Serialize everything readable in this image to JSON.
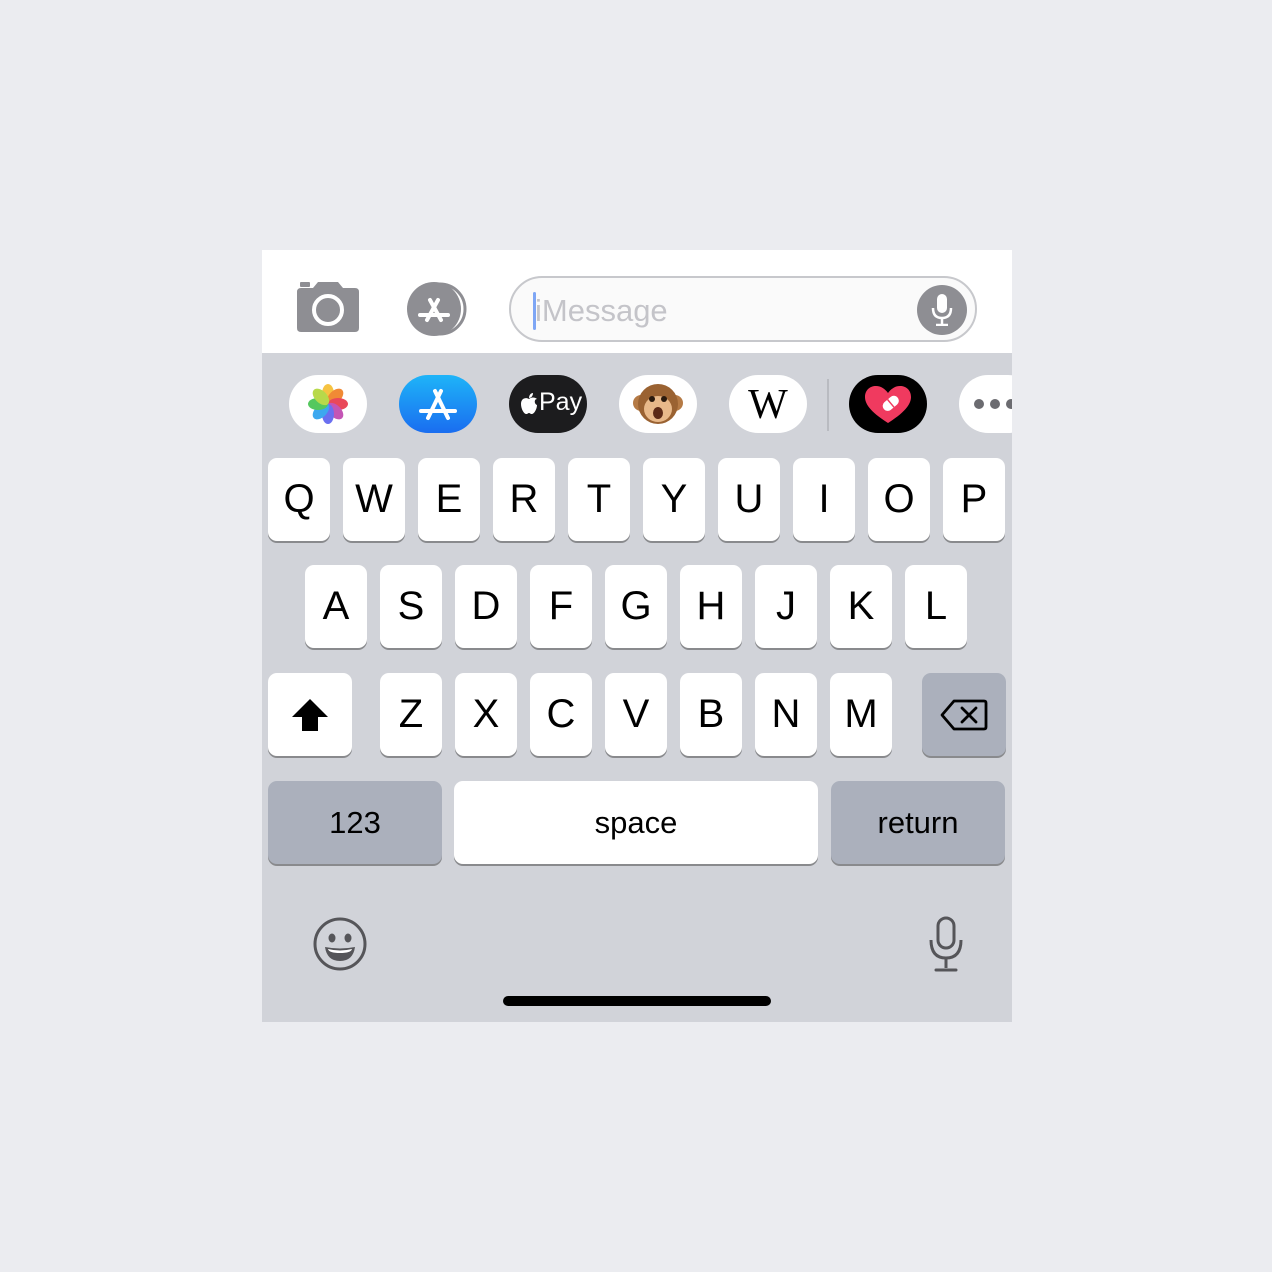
{
  "compose": {
    "placeholder": "iMessage",
    "value": ""
  },
  "app_strip": {
    "apple_pay_label": "Pay",
    "wikipedia_label": "W",
    "items": [
      "photos",
      "app-store",
      "apple-pay",
      "animoji",
      "wikipedia",
      "digital-touch",
      "more"
    ]
  },
  "keyboard": {
    "row1": [
      "Q",
      "W",
      "E",
      "R",
      "T",
      "Y",
      "U",
      "I",
      "O",
      "P"
    ],
    "row2": [
      "A",
      "S",
      "D",
      "F",
      "G",
      "H",
      "J",
      "K",
      "L"
    ],
    "row3": [
      "Z",
      "X",
      "C",
      "V",
      "B",
      "N",
      "M"
    ],
    "numbers_label": "123",
    "space_label": "space",
    "return_label": "return"
  },
  "colors": {
    "keyboard_bg": "#d1d3d9",
    "key_light": "#ffffff",
    "key_dark": "#abb0bc",
    "accent_blue": "#1a8cf5",
    "icon_gray": "#8e8e93"
  }
}
